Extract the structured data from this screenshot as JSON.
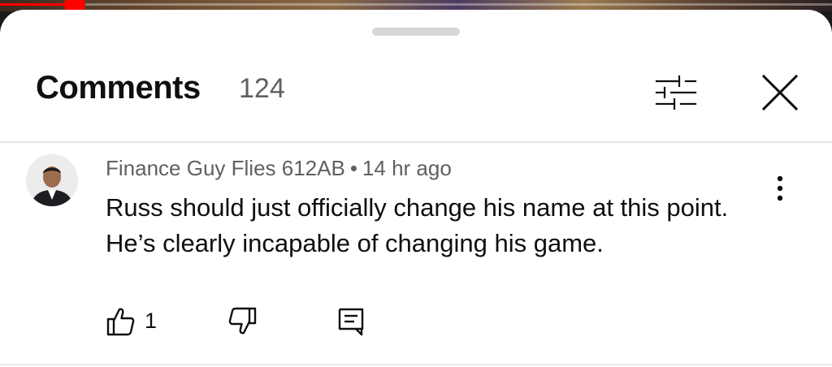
{
  "video": {
    "progress": 0.09,
    "accent_color": "#ff0000"
  },
  "comments_panel": {
    "title": "Comments",
    "count": "124",
    "filter_icon": "sliders-icon",
    "close_icon": "close-icon"
  },
  "comment": {
    "author": "Finance Guy Flies 612AB",
    "separator": "•",
    "time_ago": "14 hr ago",
    "text_line1": "Russ should just officially change his name at this point.",
    "text_line2": "He’s clearly incapable of changing his game.",
    "like_count": "1",
    "icons": {
      "like": "thumbs-up-icon",
      "dislike": "thumbs-down-icon",
      "reply": "reply-icon",
      "more": "more-vertical-icon"
    }
  }
}
